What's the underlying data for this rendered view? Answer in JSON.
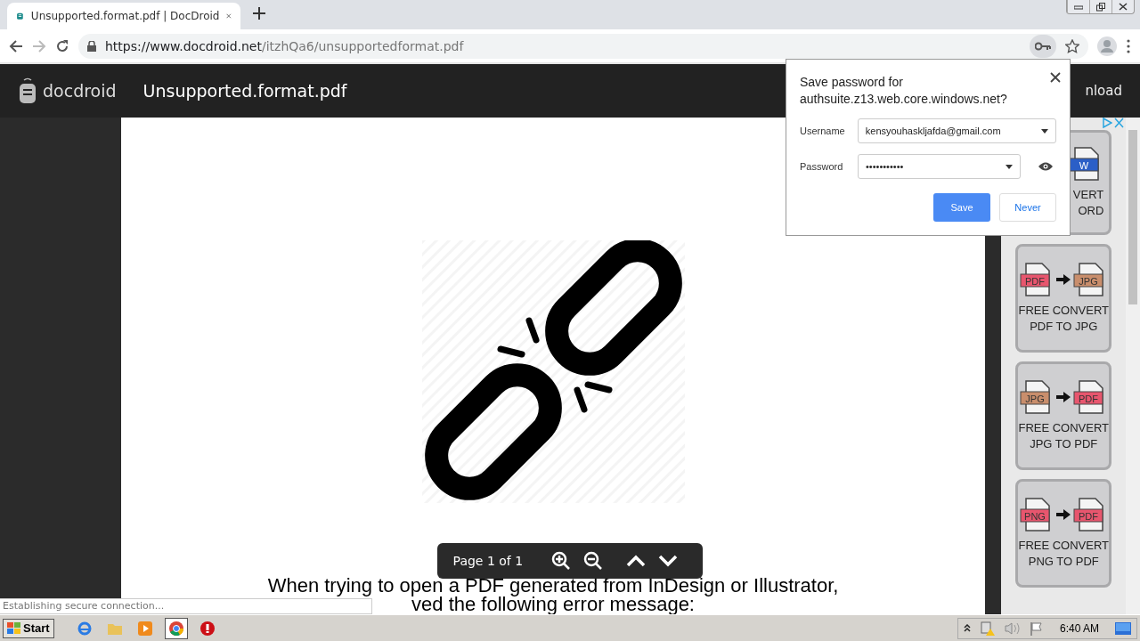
{
  "browser": {
    "tabs": [
      {
        "title": "Unsupported.format.pdf | DocDroid",
        "selected": true
      }
    ],
    "url_host": "https://www.docdroid.net",
    "url_path": "/itzhQa6/unsupportedformat.pdf"
  },
  "site_header": {
    "logo": "docdroid",
    "title": "Unsupported.format.pdf",
    "download_fragment": "nload"
  },
  "password_popup": {
    "title": "Save password for authsuite.z13.web.core.windows.net?",
    "username_label": "Username",
    "username": "kensyouhaskljafda@gmail.com",
    "password_label": "Password",
    "password": "•••••••••••",
    "buttons": [
      {
        "label": "Save",
        "primary": true
      },
      {
        "label": "Never",
        "primary": false
      }
    ]
  },
  "document": {
    "text_lines": [
      "When trying to open a PDF generated from InDesign or Illustrator,",
      "ved the following error message:"
    ]
  },
  "viewer_toolbar": {
    "page_indicator": "Page 1 of 1"
  },
  "ads": [
    {
      "to": {
        "label": "W",
        "color": "#2b5fc7"
      },
      "lines": [
        "VERT",
        "ORD"
      ]
    },
    {
      "from": {
        "label": "PDF",
        "color": "#e8566e"
      },
      "to": {
        "label": "JPG",
        "color": "#c98e6c"
      },
      "lines": [
        "FREE CONVERT",
        "PDF TO JPG"
      ]
    },
    {
      "from": {
        "label": "JPG",
        "color": "#c98e6c"
      },
      "to": {
        "label": "PDF",
        "color": "#e8566e"
      },
      "lines": [
        "FREE CONVERT",
        "JPG TO PDF"
      ]
    },
    {
      "from": {
        "label": "PNG",
        "color": "#e8566e"
      },
      "to": {
        "label": "PDF",
        "color": "#e8566e"
      },
      "lines": [
        "FREE CONVERT",
        "PNG TO PDF"
      ]
    }
  ],
  "status_bubble": "Establishing secure connection...",
  "taskbar": {
    "start": "Start",
    "clock": "6:40 AM"
  }
}
